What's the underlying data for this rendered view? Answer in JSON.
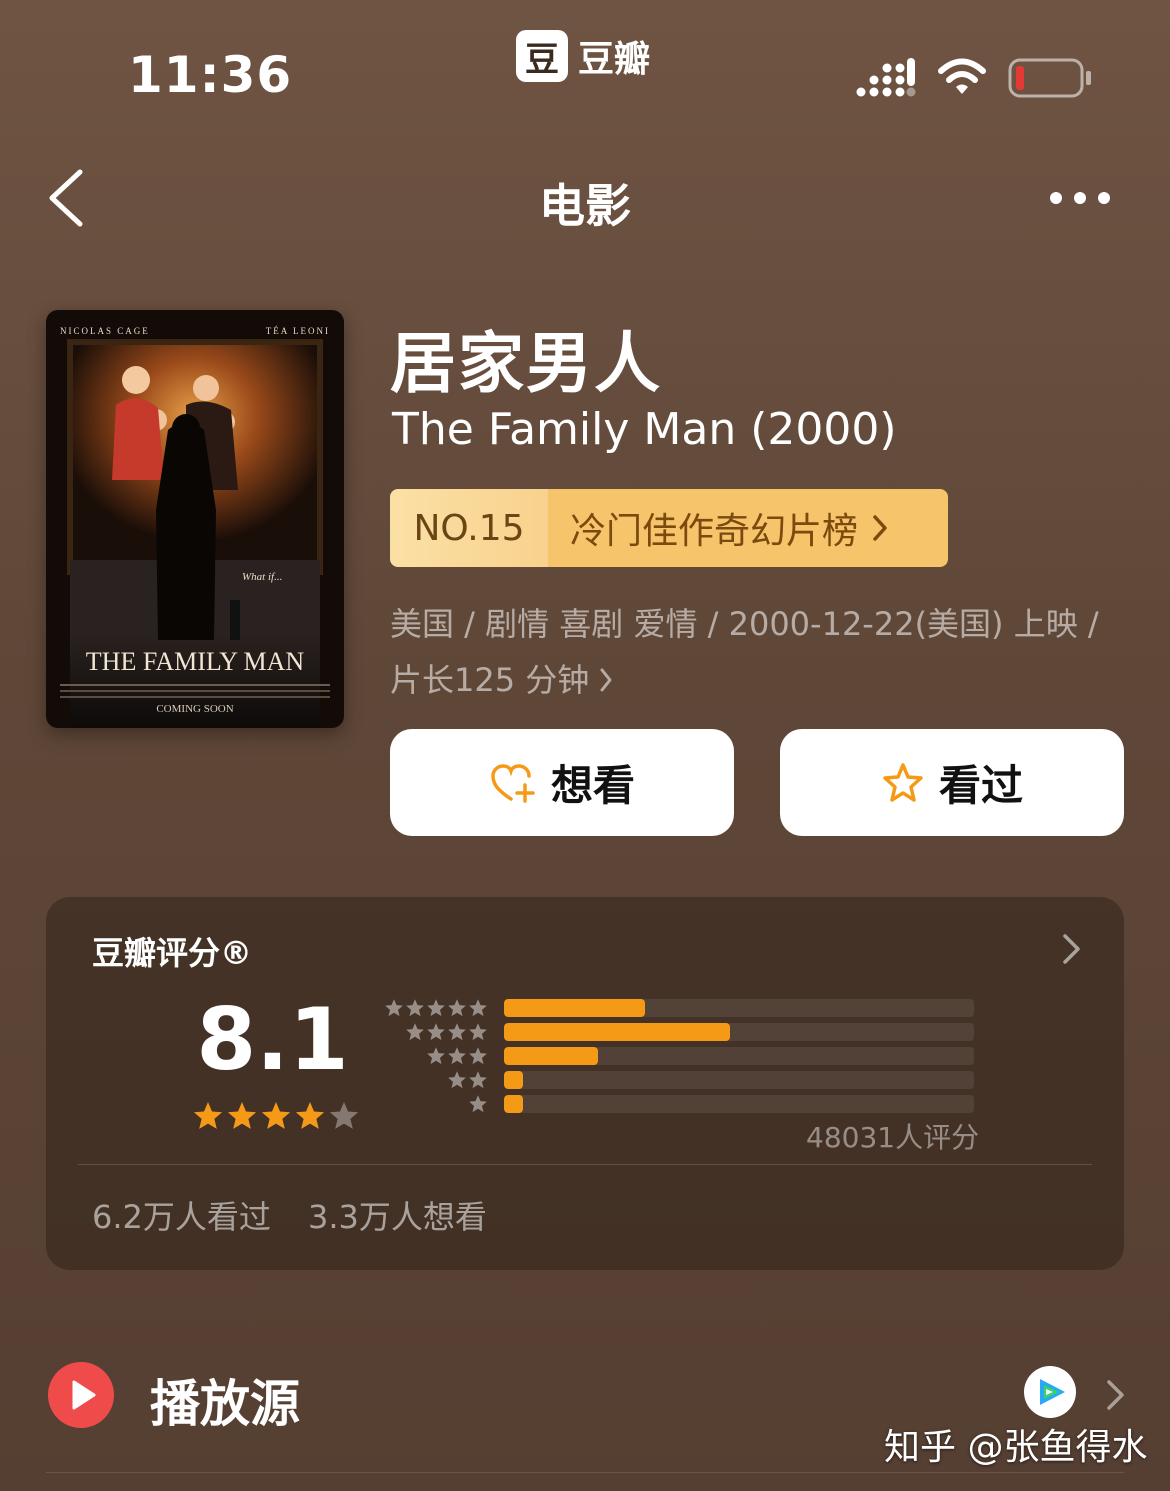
{
  "status_bar": {
    "time": "11:36",
    "app_logo_glyph": "豆",
    "app_name": "豆瓣",
    "battery_color": "#e53935"
  },
  "nav": {
    "title": "电影"
  },
  "movie": {
    "poster_actor_left": "NICOLAS CAGE",
    "poster_actor_right": "TÉA LEONI",
    "poster_tagline": "What if...",
    "poster_title": "THE FAMILY MAN",
    "poster_footer": "COMING SOON",
    "title": "居家男人",
    "subtitle": "The Family Man (2000)",
    "rank_no": "NO.15",
    "rank_list": "冷门佳作奇幻片榜",
    "meta_line1": "美国 / 剧情 喜剧 爱情 / 2000-12-22(美国) 上映 /",
    "meta_line2": "片长125 分钟"
  },
  "actions": {
    "want_label": "想看",
    "seen_label": "看过"
  },
  "rating": {
    "title": "豆瓣评分®",
    "score": "8.1",
    "score_stars": 4,
    "distribution": [
      {
        "stars": 5,
        "fraction": 0.3
      },
      {
        "stars": 4,
        "fraction": 0.48
      },
      {
        "stars": 3,
        "fraction": 0.2
      },
      {
        "stars": 2,
        "fraction": 0.04
      },
      {
        "stars": 1,
        "fraction": 0.04
      }
    ],
    "count_text": "48031人评分",
    "seen_text": "6.2万人看过",
    "want_text": "3.3万人想看",
    "bar_color": "#f59a17",
    "star_color": "#f59a17"
  },
  "play_source": {
    "title": "播放源",
    "provider_icon": "tencent-video-icon"
  },
  "watermark": "知乎 @张鱼得水"
}
